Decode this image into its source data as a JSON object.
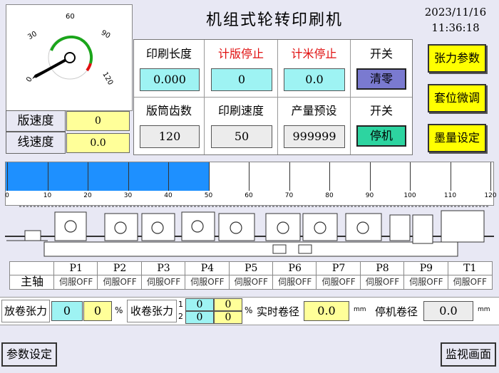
{
  "header": {
    "title": "机组式轮转印刷机",
    "date": "2023/11/16",
    "time": "11:36:18"
  },
  "gauge": {
    "tick_labels": [
      "0",
      "30",
      "60",
      "90",
      "120"
    ],
    "plate_speed_label": "版速度",
    "plate_speed_value": "0",
    "line_speed_label": "线速度",
    "line_speed_value": "0.0"
  },
  "panel": {
    "row1_headers": [
      "印刷长度",
      "计版停止",
      "计米停止",
      "开关"
    ],
    "row1_values": [
      "0.000",
      "0",
      "0.0"
    ],
    "clear_button": "清零",
    "row2_headers": [
      "版筒齿数",
      "印刷速度",
      "产量预设",
      "开关"
    ],
    "row2_values": [
      "120",
      "50",
      "999999"
    ],
    "stop_button": "停机"
  },
  "side_buttons": {
    "tension_params": "张力参数",
    "register_adjust": "套位微调",
    "ink_settings": "墨量设定"
  },
  "speed_bar": {
    "value": 50,
    "min": 0,
    "max": 120,
    "labels": [
      "0",
      "10",
      "20",
      "30",
      "40",
      "50",
      "60",
      "70",
      "80",
      "90",
      "100",
      "110",
      "120"
    ]
  },
  "servo": {
    "main_axis_label": "主轴",
    "units": [
      {
        "name": "P1",
        "status": "伺服OFF"
      },
      {
        "name": "P2",
        "status": "伺服OFF"
      },
      {
        "name": "P3",
        "status": "伺服OFF"
      },
      {
        "name": "P4",
        "status": "伺服OFF"
      },
      {
        "name": "P5",
        "status": "伺服OFF"
      },
      {
        "name": "P6",
        "status": "伺服OFF"
      },
      {
        "name": "P7",
        "status": "伺服OFF"
      },
      {
        "name": "P8",
        "status": "伺服OFF"
      },
      {
        "name": "P9",
        "status": "伺服OFF"
      },
      {
        "name": "T1",
        "status": "伺服OFF"
      }
    ]
  },
  "tension": {
    "unwind_label": "放卷张力",
    "unwind_set": "0",
    "unwind_actual": "0",
    "percent": "%",
    "rewind_label": "收卷张力",
    "rewind_row1_idx": "1",
    "rewind_row2_idx": "2",
    "rewind_r1_set": "0",
    "rewind_r1_actual": "0",
    "rewind_r2_set": "0",
    "rewind_r2_actual": "0",
    "rewind_percent": "%",
    "realtime_dia_label": "实时卷径",
    "realtime_dia_value": "0.0",
    "mm1": "mm",
    "stop_dia_label": "停机卷径",
    "stop_dia_value": "0.0",
    "mm2": "mm"
  },
  "footer": {
    "params_button": "参数设定",
    "monitor_button": "监视画面"
  }
}
